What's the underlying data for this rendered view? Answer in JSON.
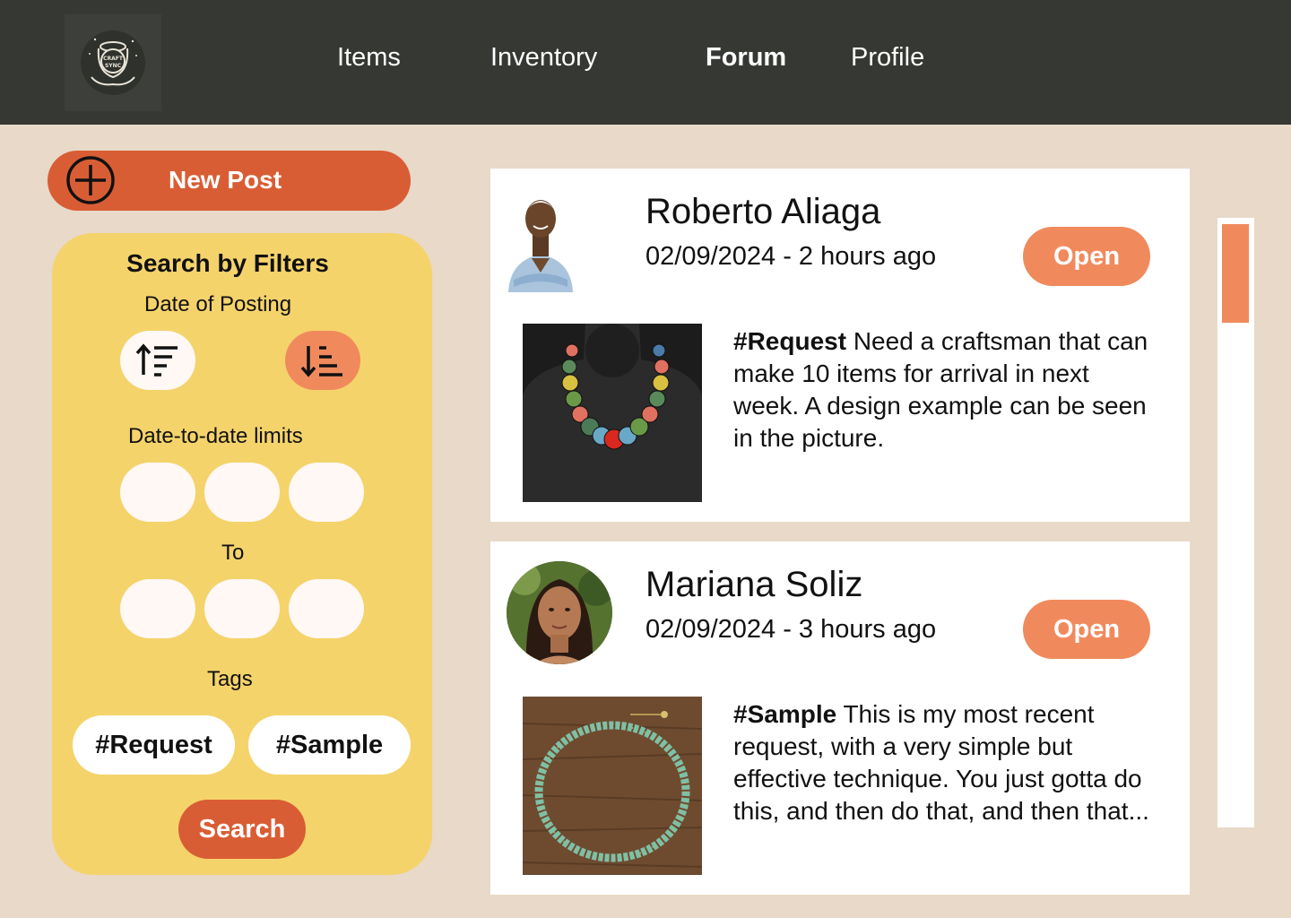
{
  "nav": {
    "logo_text_line1": "CRAFT",
    "logo_text_line2": "SYNC",
    "items": [
      "Items",
      "Inventory",
      "Forum",
      "Profile"
    ],
    "active": "Forum"
  },
  "new_post": {
    "label": "New Post",
    "icon": "plus-circle-icon"
  },
  "filters": {
    "title": "Search by Filters",
    "date_of_posting_label": "Date of Posting",
    "sort_asc_icon": "sort-ascending-icon",
    "sort_desc_icon": "sort-descending-icon",
    "date_limits_label": "Date-to-date limits",
    "to_label": "To",
    "tags_label": "Tags",
    "tags": [
      "#Request",
      "#Sample"
    ],
    "search_label": "Search"
  },
  "posts": [
    {
      "author": "Roberto Aliaga",
      "date": "02/09/2024 - 2 hours ago",
      "open_label": "Open",
      "tag": "#Request",
      "text": " Need a craftsman that can make 10 items for arrival in next week. A design example can be seen in the picture."
    },
    {
      "author": "Mariana Soliz",
      "date": "02/09/2024 - 3 hours ago",
      "open_label": "Open",
      "tag": "#Sample",
      "text": " This is my most recent request, with a very simple but effective technique. You just gotta do this, and then do that, and then that..."
    }
  ],
  "colors": {
    "topbar": "#363833",
    "background": "#e8d9c8",
    "accent_dark": "#d95d34",
    "accent_light": "#f08a5d",
    "filter_panel": "#f5d36b"
  }
}
